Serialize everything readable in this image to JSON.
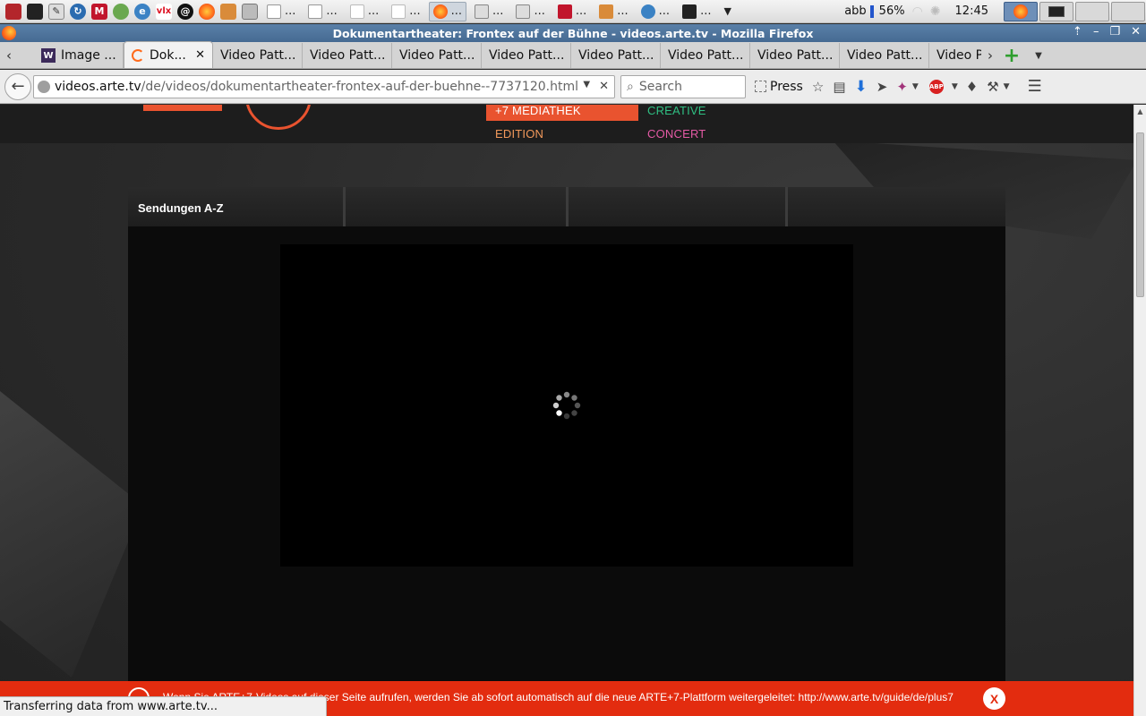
{
  "taskbar": {
    "tasks": [
      {
        "label": "...",
        "icon": "firefox-icon"
      },
      {
        "label": "...",
        "icon": "text-editor-icon"
      },
      {
        "label": "...",
        "icon": "text-editor-icon"
      },
      {
        "label": "...",
        "icon": "media-icon"
      },
      {
        "label": "...",
        "icon": "archive-icon"
      },
      {
        "label": "...",
        "icon": "chromium-icon"
      },
      {
        "label": "...",
        "icon": "terminal-icon"
      }
    ],
    "file_tasks": [
      "...",
      "...",
      "...",
      "..."
    ],
    "keyboard_layout": "abb",
    "battery": "56%",
    "clock": "12:45"
  },
  "window": {
    "title": "Dokumentartheater: Frontex auf der Bühne - videos.arte.tv - Mozilla Firefox"
  },
  "tabs": [
    {
      "label": "Image ...",
      "icon": "wikipedia-icon",
      "selected": false
    },
    {
      "label": "Dok...",
      "icon": "loading-icon",
      "selected": true
    },
    {
      "label": "Video Patt...",
      "selected": false
    },
    {
      "label": "Video Patt...",
      "selected": false
    },
    {
      "label": "Video Patt...",
      "selected": false
    },
    {
      "label": "Video Patt...",
      "selected": false
    },
    {
      "label": "Video Patt...",
      "selected": false
    },
    {
      "label": "Video Patt...",
      "selected": false
    },
    {
      "label": "Video Patt...",
      "selected": false
    },
    {
      "label": "Video Patt...",
      "selected": false
    },
    {
      "label": "Video P",
      "selected": false
    }
  ],
  "navbar": {
    "url_host": "videos.arte.tv",
    "url_path": "/de/videos/dokumentartheater-frontex-auf-der-buehne--7737120.html",
    "search_placeholder": "Search",
    "press_label": "Press"
  },
  "site": {
    "menu": {
      "mediathek": "+7 MEDIATHEK",
      "creative": "CREATIVE",
      "edition": "EDITION",
      "concert": "CONCERT"
    },
    "az_label": "Sendungen A-Z",
    "notice_text": "Wenn Sie ARTE+7-Videos auf dieser Seite aufrufen, werden Sie ab sofort automatisch auf die neue ARTE+7-Plattform weitergeleitet: http://www.arte.tv/guide/de/plus7",
    "notice_close": "X"
  },
  "status_text": "Transferring data from www.arte.tv...",
  "colors": {
    "arte_orange": "#e9532f",
    "creative_green": "#2fbf82",
    "edition_orange": "#f2995b",
    "concert_pink": "#e45aa5",
    "notice_red": "#e32c0f"
  }
}
